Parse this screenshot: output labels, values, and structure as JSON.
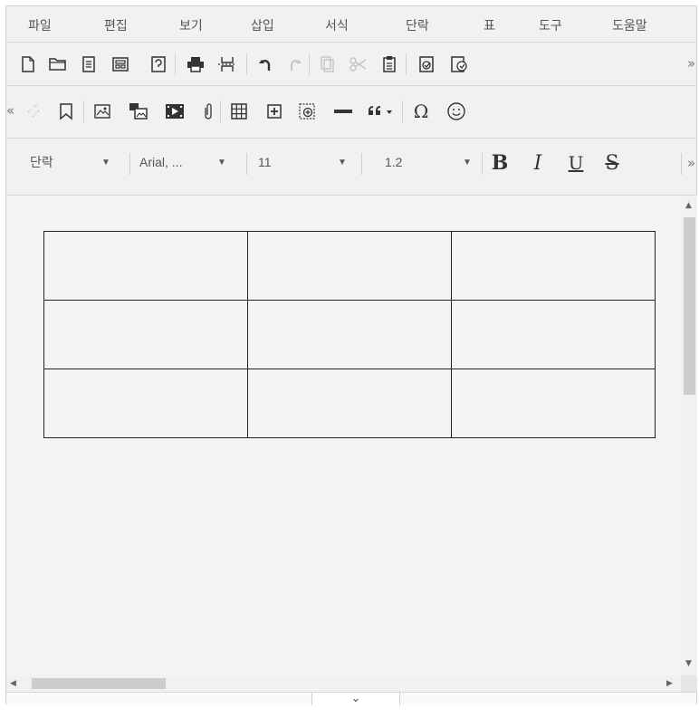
{
  "menubar": {
    "items": [
      {
        "label": "파일"
      },
      {
        "label": "편집"
      },
      {
        "label": "보기"
      },
      {
        "label": "삽입"
      },
      {
        "label": "서식"
      },
      {
        "label": "단락"
      },
      {
        "label": "표"
      },
      {
        "label": "도구"
      },
      {
        "label": "도움말"
      }
    ]
  },
  "toolbar1": {
    "icons": [
      "new-document-icon",
      "open-folder-icon",
      "document-icon",
      "template-icon",
      "preview-icon",
      "print-icon",
      "page-break-icon",
      "undo-icon",
      "redo-icon",
      "copy-icon",
      "cut-icon",
      "paste-icon",
      "spellcheck-icon",
      "proofread-icon"
    ],
    "more": "»"
  },
  "toolbar2": {
    "collapse": "«",
    "icons": [
      "unlink-icon",
      "bookmark-icon",
      "image-icon",
      "image-edit-icon",
      "video-icon",
      "attachment-icon",
      "table-icon",
      "insert-box-icon",
      "insert-layer-icon",
      "horizontal-line-icon",
      "quote-icon",
      "special-char-icon",
      "emoji-icon"
    ],
    "special_char": "Ω"
  },
  "format_bar": {
    "paragraph": "단락",
    "font": "Arial, ...",
    "size": "11",
    "line_height": "1.2",
    "bold": "B",
    "italic": "I",
    "underline": "U",
    "strike": "S",
    "more": "»",
    "arrow": "▼"
  },
  "document": {
    "table": {
      "rows": 3,
      "cols": 3,
      "cells": [
        [
          "",
          "",
          ""
        ],
        [
          "",
          "",
          ""
        ],
        [
          "",
          "",
          ""
        ]
      ]
    }
  },
  "scrollbars": {
    "up": "▲",
    "down": "▼",
    "left": "◀",
    "right": "▶"
  },
  "statusbar": {
    "toggle": "⌄"
  }
}
